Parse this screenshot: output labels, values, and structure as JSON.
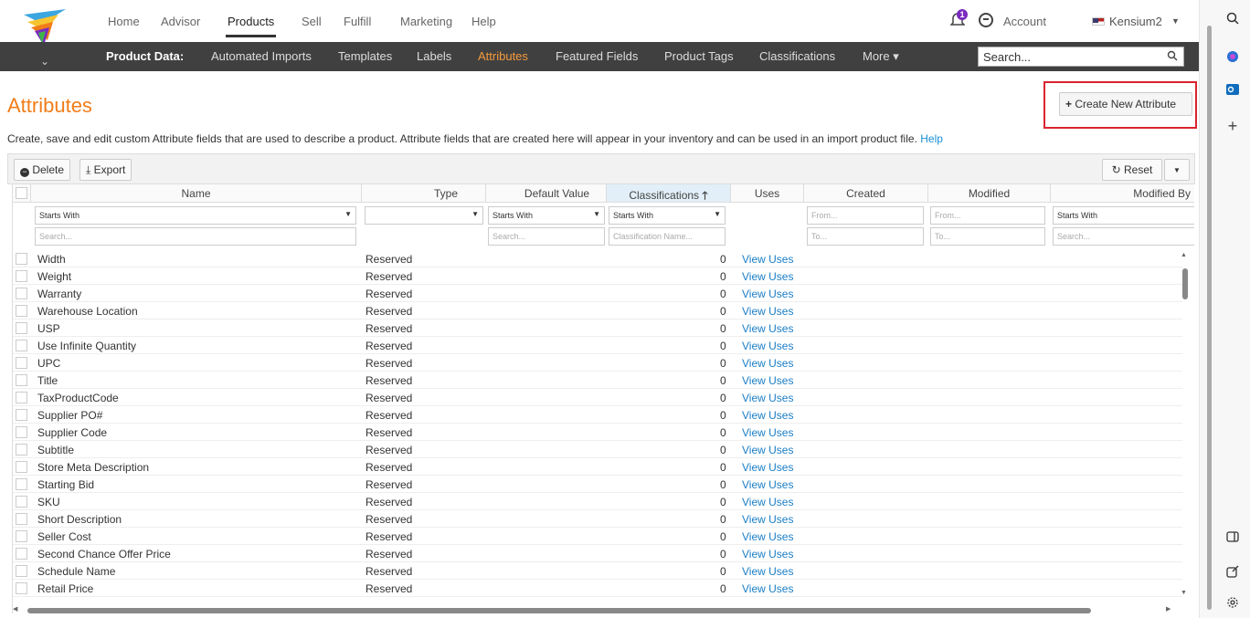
{
  "topnav": {
    "items": [
      "Home",
      "Advisor",
      "Products",
      "Sell",
      "Fulfill",
      "Marketing",
      "Help"
    ],
    "active": "Products",
    "notification_count": "1",
    "account_label": "Account",
    "user_label": "Kensium2"
  },
  "subnav": {
    "label": "Product Data:",
    "items": [
      "Automated Imports",
      "Templates",
      "Labels",
      "Attributes",
      "Featured Fields",
      "Product Tags",
      "Classifications",
      "More ▾"
    ],
    "active": "Attributes",
    "search_placeholder": "Search..."
  },
  "page": {
    "title": "Attributes",
    "create_button": "Create New Attribute",
    "description": "Create, save and edit custom Attribute fields that are used to describe a product. Attribute fields that are created here will appear in your inventory and can be used in an import product file.",
    "help_link": "Help"
  },
  "toolbar": {
    "delete_label": "Delete",
    "export_label": "Export",
    "reset_label": "Reset"
  },
  "grid": {
    "columns": [
      "Name",
      "Type",
      "Default Value",
      "Classifications",
      "Uses",
      "Created",
      "Modified",
      "Modified By"
    ],
    "filters": {
      "name_mode": "Starts With",
      "name_placeholder": "Search...",
      "default_mode": "Starts With",
      "default_placeholder": "Search...",
      "class_mode": "Starts With",
      "class_placeholder": "Classification Name...",
      "created_from": "From...",
      "created_to": "To...",
      "modified_from": "From...",
      "modified_to": "To...",
      "modby_mode": "Starts With",
      "modby_placeholder": "Search..."
    },
    "rows": [
      {
        "name": "Width",
        "type": "Reserved",
        "classifications": "0",
        "uses": "View Uses"
      },
      {
        "name": "Weight",
        "type": "Reserved",
        "classifications": "0",
        "uses": "View Uses"
      },
      {
        "name": "Warranty",
        "type": "Reserved",
        "classifications": "0",
        "uses": "View Uses"
      },
      {
        "name": "Warehouse Location",
        "type": "Reserved",
        "classifications": "0",
        "uses": "View Uses"
      },
      {
        "name": "USP",
        "type": "Reserved",
        "classifications": "0",
        "uses": "View Uses"
      },
      {
        "name": "Use Infinite Quantity",
        "type": "Reserved",
        "classifications": "0",
        "uses": "View Uses"
      },
      {
        "name": "UPC",
        "type": "Reserved",
        "classifications": "0",
        "uses": "View Uses"
      },
      {
        "name": "Title",
        "type": "Reserved",
        "classifications": "0",
        "uses": "View Uses"
      },
      {
        "name": "TaxProductCode",
        "type": "Reserved",
        "classifications": "0",
        "uses": "View Uses"
      },
      {
        "name": "Supplier PO#",
        "type": "Reserved",
        "classifications": "0",
        "uses": "View Uses"
      },
      {
        "name": "Supplier Code",
        "type": "Reserved",
        "classifications": "0",
        "uses": "View Uses"
      },
      {
        "name": "Subtitle",
        "type": "Reserved",
        "classifications": "0",
        "uses": "View Uses"
      },
      {
        "name": "Store Meta Description",
        "type": "Reserved",
        "classifications": "0",
        "uses": "View Uses"
      },
      {
        "name": "Starting Bid",
        "type": "Reserved",
        "classifications": "0",
        "uses": "View Uses"
      },
      {
        "name": "SKU",
        "type": "Reserved",
        "classifications": "0",
        "uses": "View Uses"
      },
      {
        "name": "Short Description",
        "type": "Reserved",
        "classifications": "0",
        "uses": "View Uses"
      },
      {
        "name": "Seller Cost",
        "type": "Reserved",
        "classifications": "0",
        "uses": "View Uses"
      },
      {
        "name": "Second Chance Offer Price",
        "type": "Reserved",
        "classifications": "0",
        "uses": "View Uses"
      },
      {
        "name": "Schedule Name",
        "type": "Reserved",
        "classifications": "0",
        "uses": "View Uses"
      },
      {
        "name": "Retail Price",
        "type": "Reserved",
        "classifications": "0",
        "uses": "View Uses"
      }
    ]
  },
  "colors": {
    "accent": "#f07d1a",
    "subnav_bg": "#404040",
    "link": "#1a7ec6",
    "highlight_box": "#d9232e"
  }
}
